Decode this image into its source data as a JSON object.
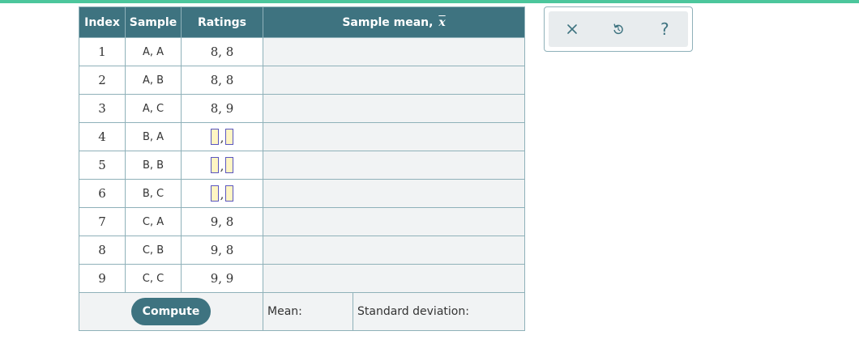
{
  "table": {
    "headers": {
      "index": "Index",
      "sample": "Sample",
      "ratings": "Ratings",
      "mean": "Sample mean,",
      "mean_symbol": "x"
    },
    "rows": [
      {
        "index": "1",
        "sample": "A, A",
        "ratings": "8, 8"
      },
      {
        "index": "2",
        "sample": "A, B",
        "ratings": "8, 8"
      },
      {
        "index": "3",
        "sample": "A, C",
        "ratings": "8, 9"
      },
      {
        "index": "4",
        "sample": "B, A",
        "ratings": null
      },
      {
        "index": "5",
        "sample": "B, B",
        "ratings": null
      },
      {
        "index": "6",
        "sample": "B, C",
        "ratings": null
      },
      {
        "index": "7",
        "sample": "C, A",
        "ratings": "9, 8"
      },
      {
        "index": "8",
        "sample": "C, B",
        "ratings": "9, 8"
      },
      {
        "index": "9",
        "sample": "C, C",
        "ratings": "9, 9"
      }
    ],
    "rating_separator": ",",
    "footer": {
      "compute_label": "Compute",
      "mean_label": "Mean:",
      "sd_label": "Standard deviation:"
    }
  },
  "toolbar": {
    "close_icon": "close-icon",
    "reset_icon": "undo-icon",
    "help_label": "?"
  },
  "colors": {
    "header_bg": "#3e7380",
    "top_bar": "#4cc69c",
    "slot_bg": "#fff5c4",
    "slot_border": "#5a56c0"
  }
}
